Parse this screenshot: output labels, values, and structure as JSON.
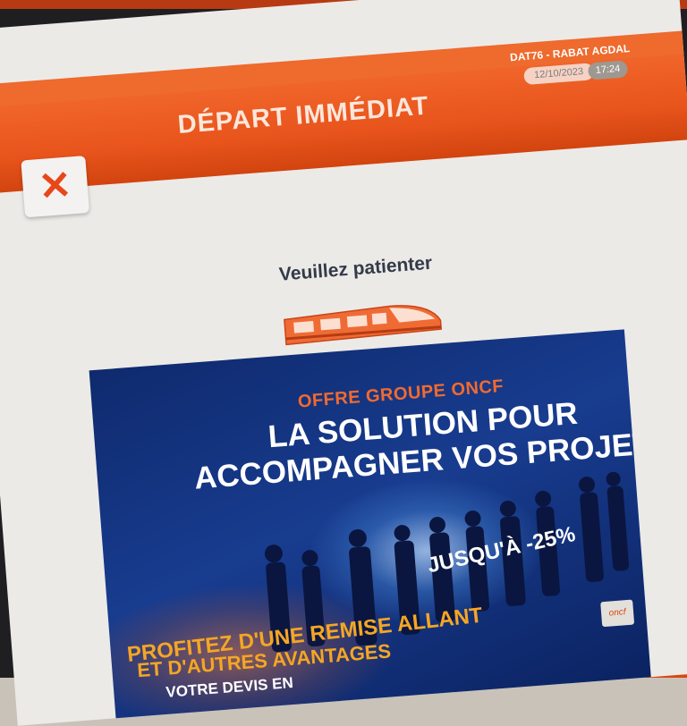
{
  "header": {
    "title": "DÉPART IMMÉDIAT",
    "station_info": "DAT76 - RABAT AGDAL",
    "date": "12/10/2023",
    "time": "17:24"
  },
  "close_button": {
    "label": "✕"
  },
  "status": {
    "message": "Veuillez patienter"
  },
  "promo": {
    "kicker": "OFFRE GROUPE ONCF",
    "headline_line1": "LA SOLUTION POUR",
    "headline_line2": "ACCOMPAGNER VOS PROJETS",
    "discount_text": "JUSQU'À -25%",
    "cta_line1": "PROFITEZ D'UNE REMISE ALLANT",
    "cta_line2": "ET D'AUTRES AVANTAGES",
    "devis_text": "VOTRE DEVIS EN"
  },
  "colors": {
    "brand_orange": "#e8541c",
    "banner_blue": "#183c8f",
    "promo_orange": "#f26a2e"
  }
}
